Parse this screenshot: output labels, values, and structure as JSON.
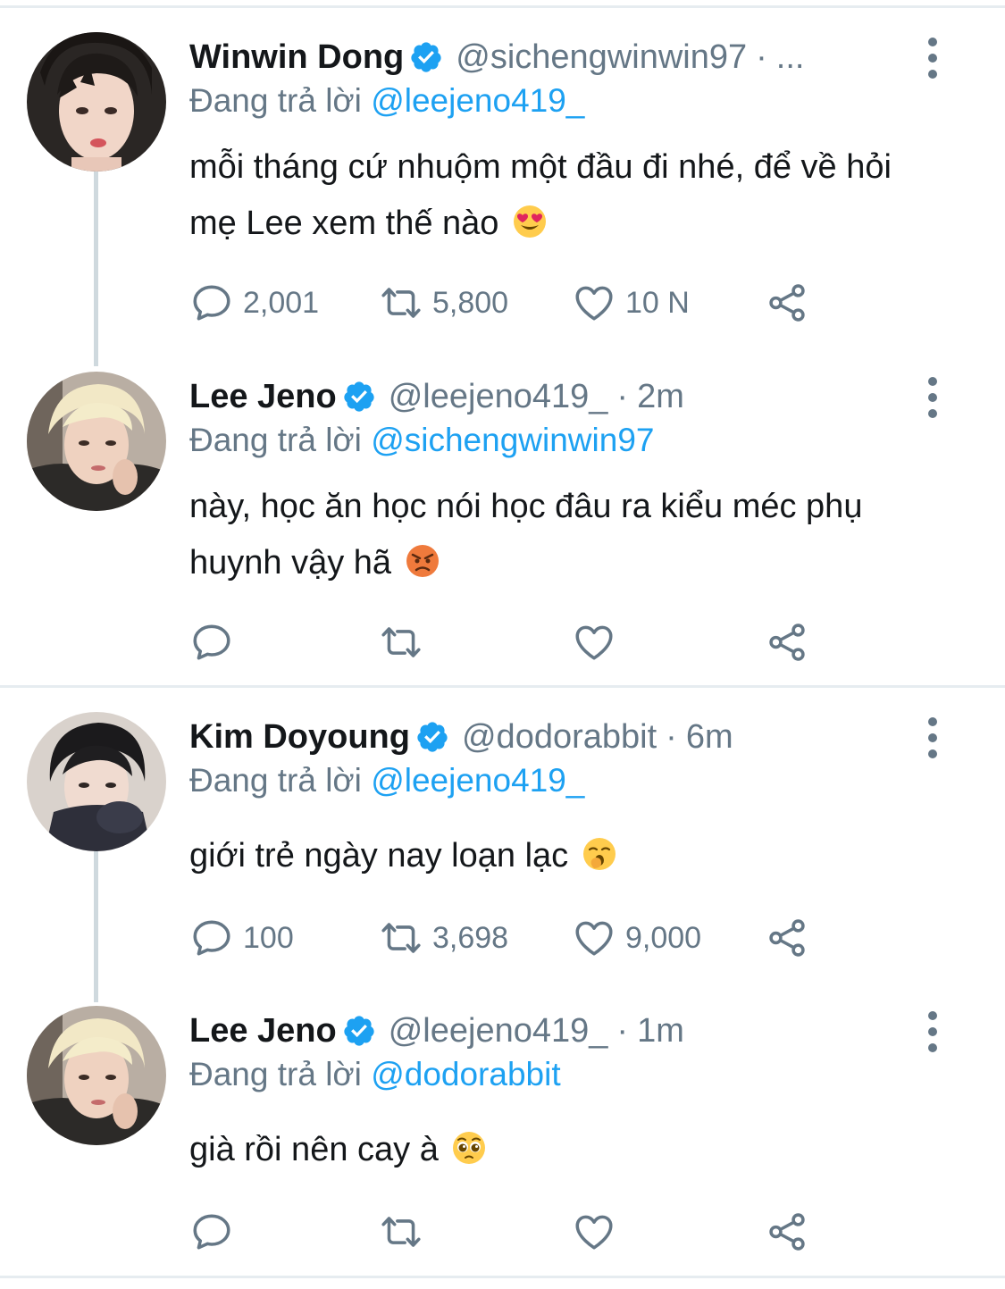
{
  "tweets": [
    {
      "name": "Winwin Dong",
      "handle": "@sichengwinwin97",
      "separator": "·",
      "time": "...",
      "reply_prefix": "Đang trả lời",
      "reply_mention": "@leejeno419_",
      "text": "mỗi tháng cứ nhuộm một đầu đi nhé, để về hỏi mẹ Lee xem thế nào",
      "emoji": "heart-eyes-emoji",
      "replies": "2,001",
      "retweets": "5,800",
      "likes": "10 N"
    },
    {
      "name": "Lee Jeno",
      "handle": "@leejeno419_",
      "separator": "·",
      "time": "2m",
      "reply_prefix": "Đang trả lời",
      "reply_mention": "@sichengwinwin97",
      "text": "này, học ăn học nói học đâu ra kiểu méc phụ huynh vậy hã",
      "emoji": "angry-face-emoji",
      "replies": "",
      "retweets": "",
      "likes": ""
    },
    {
      "name": "Kim Doyoung",
      "handle": "@dodorabbit",
      "separator": "·",
      "time": "6m",
      "reply_prefix": "Đang trả lời",
      "reply_mention": "@leejeno419_",
      "text": "giới trẻ ngày nay loạn lạc",
      "emoji": "yawning-face-emoji",
      "replies": "100",
      "retweets": "3,698",
      "likes": "9,000"
    },
    {
      "name": "Lee Jeno",
      "handle": "@leejeno419_",
      "separator": "·",
      "time": "1m",
      "reply_prefix": "Đang trả lời",
      "reply_mention": "@dodorabbit",
      "text": "già rồi nên cay à",
      "emoji": "pleading-face-emoji",
      "replies": "",
      "retweets": "",
      "likes": ""
    }
  ],
  "colors": {
    "accent": "#1da1f2",
    "secondary_text": "#657786",
    "primary_text": "#14171a",
    "divider": "#e6ecf0",
    "thread_line": "#cfd9de"
  }
}
